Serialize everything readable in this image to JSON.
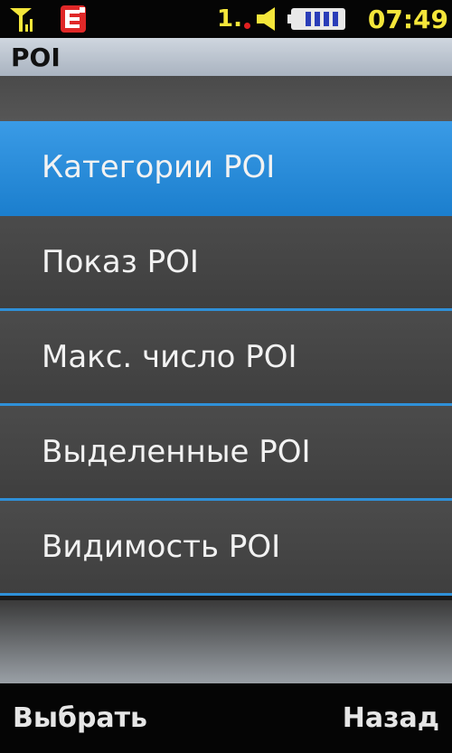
{
  "status": {
    "sim_number": "1.",
    "time": "07:49",
    "icons": [
      "signal-antenna-icon",
      "edge-icon",
      "speaker-icon",
      "battery-icon"
    ],
    "accent": "#f4e63a"
  },
  "title": "POI",
  "menu": {
    "items": [
      {
        "label": "Категории POI",
        "selected": true
      },
      {
        "label": "Показ POI",
        "selected": false
      },
      {
        "label": "Макс. число POI",
        "selected": false
      },
      {
        "label": "Выделенные POI",
        "selected": false
      },
      {
        "label": "Видимость POI",
        "selected": false
      }
    ],
    "highlight_color": "#2f90d8"
  },
  "softkeys": {
    "left": "Выбрать",
    "right": "Назад"
  }
}
